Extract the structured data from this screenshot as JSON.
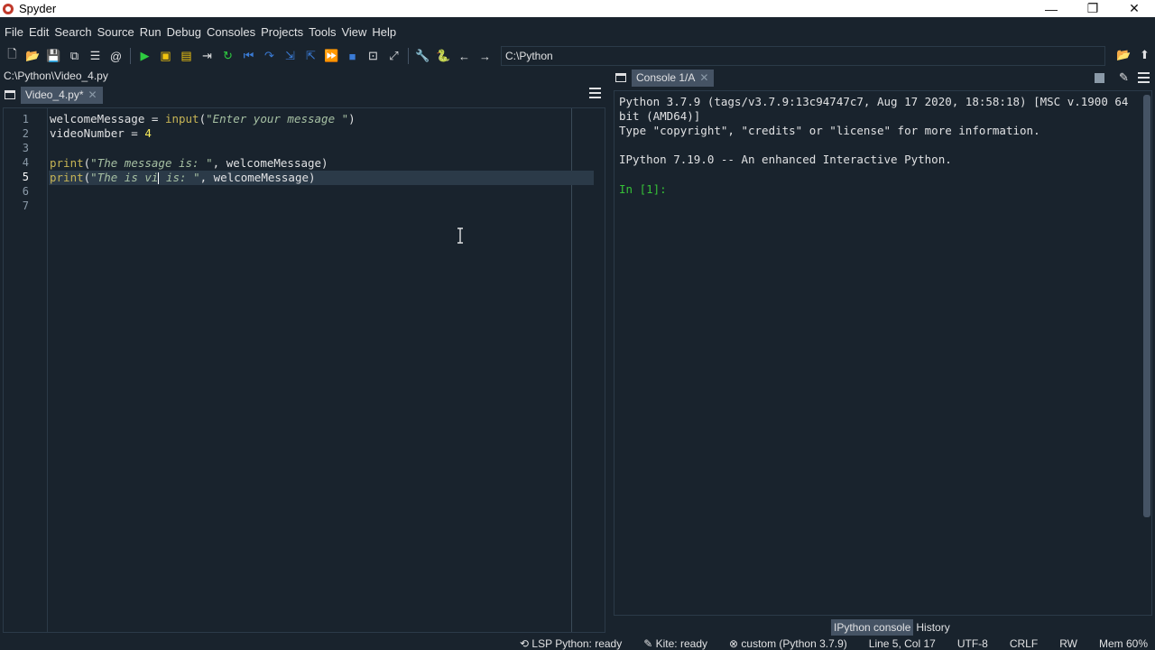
{
  "window": {
    "title": "Spyder",
    "minimize": "—",
    "maximize": "❐",
    "close": "✕"
  },
  "menu": [
    "File",
    "Edit",
    "Search",
    "Source",
    "Run",
    "Debug",
    "Consoles",
    "Projects",
    "Tools",
    "View",
    "Help"
  ],
  "toolbar": {
    "path": "C:\\Python"
  },
  "editor": {
    "file_path": "C:\\Python\\Video_4.py",
    "tab_label": "Video_4.py*",
    "line_numbers": [
      "1",
      "2",
      "3",
      "4",
      "5",
      "6",
      "7"
    ],
    "current_line": 5,
    "lines": [
      "welcomeMessage = input(\"Enter your message \")",
      "videoNumber = 4",
      "",
      "print(\"The message is: \", welcomeMessage)",
      "print(\"The is vi| is: \", welcomeMessage)",
      "",
      ""
    ]
  },
  "console": {
    "tab_label": "Console 1/A",
    "lines": [
      "Python 3.7.9 (tags/v3.7.9:13c94747c7, Aug 17 2020, 18:58:18) [MSC v.1900 64",
      "bit (AMD64)]",
      "Type \"copyright\", \"credits\" or \"license\" for more information.",
      "",
      "IPython 7.19.0 -- An enhanced Interactive Python.",
      "",
      "In [1]:"
    ],
    "bottom_tabs": [
      "IPython console",
      "History"
    ]
  },
  "statusbar": {
    "lsp": "LSP Python: ready",
    "kite": "Kite: ready",
    "env": "custom (Python 3.7.9)",
    "position": "Line 5, Col 17",
    "encoding": "UTF-8",
    "eol": "CRLF",
    "mode": "RW",
    "memory": "Mem 60%"
  }
}
